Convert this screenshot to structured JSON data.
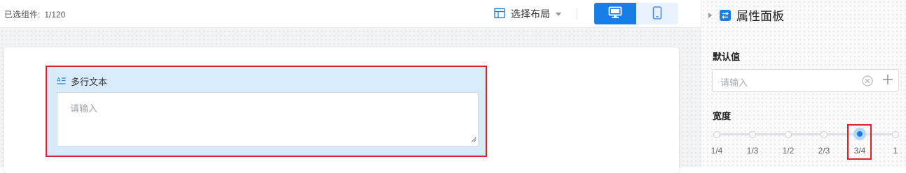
{
  "toolbar": {
    "selected_label": "已选组件:",
    "selected_value": "1/120",
    "layout_label": "选择布局",
    "device_modes": [
      "desktop",
      "mobile"
    ],
    "active_device": "desktop"
  },
  "form": {
    "field_title": "多行文本",
    "field_placeholder": "请输入"
  },
  "panel": {
    "title": "属性面板",
    "default_value_label": "默认值",
    "default_value_placeholder": "请输入",
    "width_label": "宽度",
    "width_options": [
      "1/4",
      "1/3",
      "1/2",
      "2/3",
      "3/4",
      "1"
    ],
    "width_selected": "3/4"
  },
  "colors": {
    "accent": "#1a7ee8",
    "selection_border": "#d9222a",
    "selected_field_bg": "#d8ebfb"
  }
}
